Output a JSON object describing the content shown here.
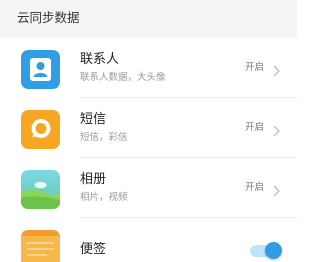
{
  "section": {
    "title": "云同步数据"
  },
  "items": [
    {
      "title": "联系人",
      "subtitle": "联系人数据，大头像",
      "status": "开启",
      "icon": "contacts-icon",
      "icon_color": "#2f9ee6"
    },
    {
      "title": "短信",
      "subtitle": "短信，彩信",
      "status": "开启",
      "icon": "messages-icon",
      "icon_color": "#f6a623"
    },
    {
      "title": "相册",
      "subtitle": "相片，视频",
      "status": "开启",
      "icon": "gallery-icon",
      "icon_color": "#5ec9a8"
    },
    {
      "title": "便签",
      "icon": "notes-icon",
      "icon_color": "#f7b84b",
      "toggle_on": true
    }
  ],
  "colors": {
    "toggle_track": "#bfe3f7",
    "toggle_knob": "#2f9ee6"
  }
}
